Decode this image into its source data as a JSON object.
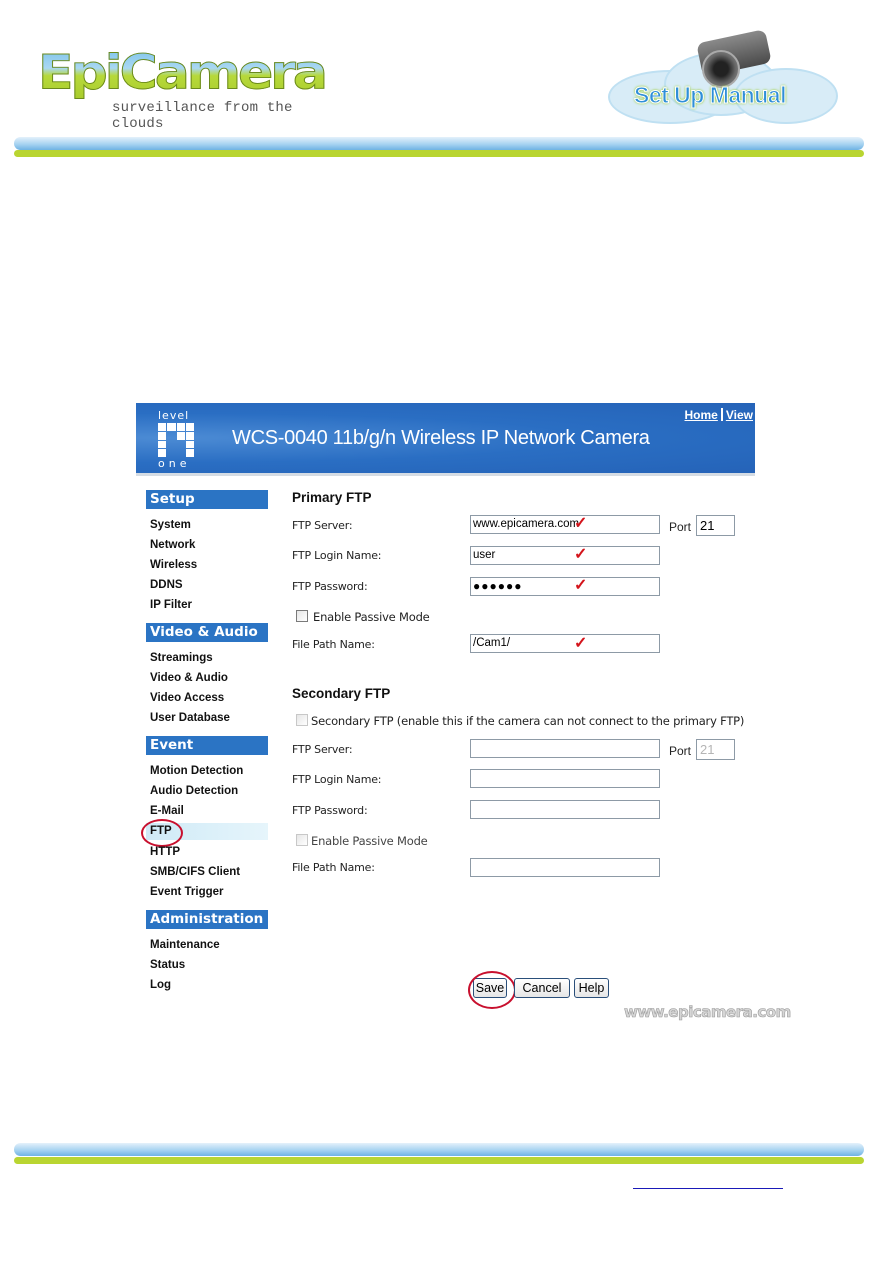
{
  "header": {
    "brand_name": "EpiCamera",
    "brand_tagline": "surveillance from the clouds",
    "badge_label": "Set Up Manual"
  },
  "camera_ui": {
    "vendor_logo_top": "level",
    "vendor_logo_bottom": "one",
    "title": "WCS-0040 11b/g/n Wireless IP Network Camera",
    "top_links": [
      "Home",
      "View"
    ],
    "sidebar": {
      "sections": [
        {
          "title": "Setup",
          "items": [
            "System",
            "Network",
            "Wireless",
            "DDNS",
            "IP Filter"
          ]
        },
        {
          "title": "Video & Audio",
          "items": [
            "Streamings",
            "Video & Audio",
            "Video Access",
            "User Database"
          ]
        },
        {
          "title": "Event",
          "items": [
            "Motion Detection",
            "Audio Detection",
            "E-Mail",
            "FTP",
            "HTTP",
            "SMB/CIFS Client",
            "Event Trigger"
          ]
        },
        {
          "title": "Administration",
          "items": [
            "Maintenance",
            "Status",
            "Log"
          ]
        }
      ],
      "active_item": "FTP"
    },
    "primary_ftp": {
      "title": "Primary FTP",
      "server_label": "FTP Server:",
      "server_value": "www.epicamera.com",
      "port_label": "Port",
      "port_value": "21",
      "login_label": "FTP Login Name:",
      "login_value": "user",
      "password_label": "FTP Password:",
      "password_value": "●●●●●●",
      "passive_label": "Enable Passive Mode",
      "passive_checked": false,
      "path_label": "File Path Name:",
      "path_value": "/Cam1/"
    },
    "secondary_ftp": {
      "title": "Secondary FTP",
      "enable_label": "Secondary FTP (enable this if the camera can not connect to the primary FTP)",
      "enable_checked": false,
      "server_label": "FTP Server:",
      "server_value": "",
      "port_label": "Port",
      "port_value": "21",
      "login_label": "FTP Login Name:",
      "login_value": "",
      "password_label": "FTP Password:",
      "password_value": "",
      "passive_label": "Enable Passive Mode",
      "passive_checked": false,
      "path_label": "File Path Name:",
      "path_value": ""
    },
    "buttons": {
      "save": "Save",
      "cancel": "Cancel",
      "help": "Help"
    },
    "watermark": "www.epicamera.com",
    "annotation_mark": "✓"
  },
  "colors": {
    "accent_blue": "#2b74c4",
    "brand_green": "#b9d531",
    "annotation_red": "#c8102e"
  }
}
